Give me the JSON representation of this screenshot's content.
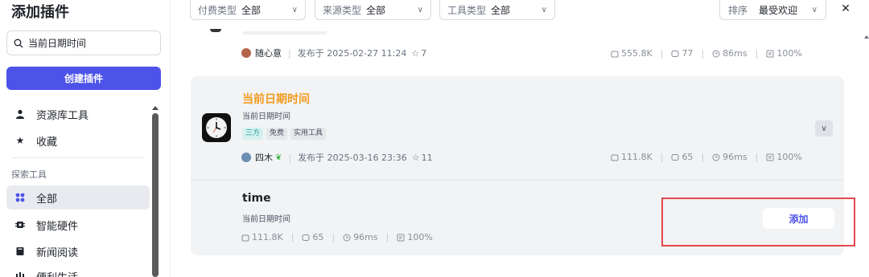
{
  "sidebar": {
    "title": "添加插件",
    "search_value": "当前日期时间",
    "create_button": "创建插件",
    "items_top": [
      {
        "label": "资源库工具",
        "icon": "person-icon"
      },
      {
        "label": "收藏",
        "icon": "star-icon"
      }
    ],
    "section_label": "探索工具",
    "items_explore": [
      {
        "label": "全部",
        "icon": "grid-icon",
        "active": true
      },
      {
        "label": "智能硬件",
        "icon": "chip-icon"
      },
      {
        "label": "新闻阅读",
        "icon": "book-icon"
      },
      {
        "label": "便利生活",
        "icon": "building-icon"
      }
    ]
  },
  "filters": [
    {
      "label": "付费类型",
      "value": "全部"
    },
    {
      "label": "来源类型",
      "value": "全部"
    },
    {
      "label": "工具类型",
      "value": "全部"
    }
  ],
  "sort": {
    "label": "排序",
    "value": "最受欢迎"
  },
  "plugins": [
    {
      "author": "随心意",
      "published": "发布于 2025-02-27 11:24",
      "stars": "7",
      "stats": {
        "calls": "555.8K",
        "comments": "77",
        "latency": "86ms",
        "success": "100%"
      }
    },
    {
      "title": "当前日期时间",
      "description": "当前日期时间",
      "tags": [
        "三方",
        "免费",
        "实用工具"
      ],
      "author": "四木",
      "published": "发布于 2025-03-16 23:36",
      "stars": "11",
      "stats": {
        "calls": "111.8K",
        "comments": "65",
        "latency": "96ms",
        "success": "100%"
      },
      "tool": {
        "name": "time",
        "description": "当前日期时间",
        "stats": {
          "calls": "111.8K",
          "comments": "65",
          "latency": "96ms",
          "success": "100%"
        },
        "add_label": "添加"
      }
    }
  ],
  "colors": {
    "accent": "#4d53e8",
    "plugin_title": "#f39c1f",
    "highlight": "#e5484d"
  }
}
